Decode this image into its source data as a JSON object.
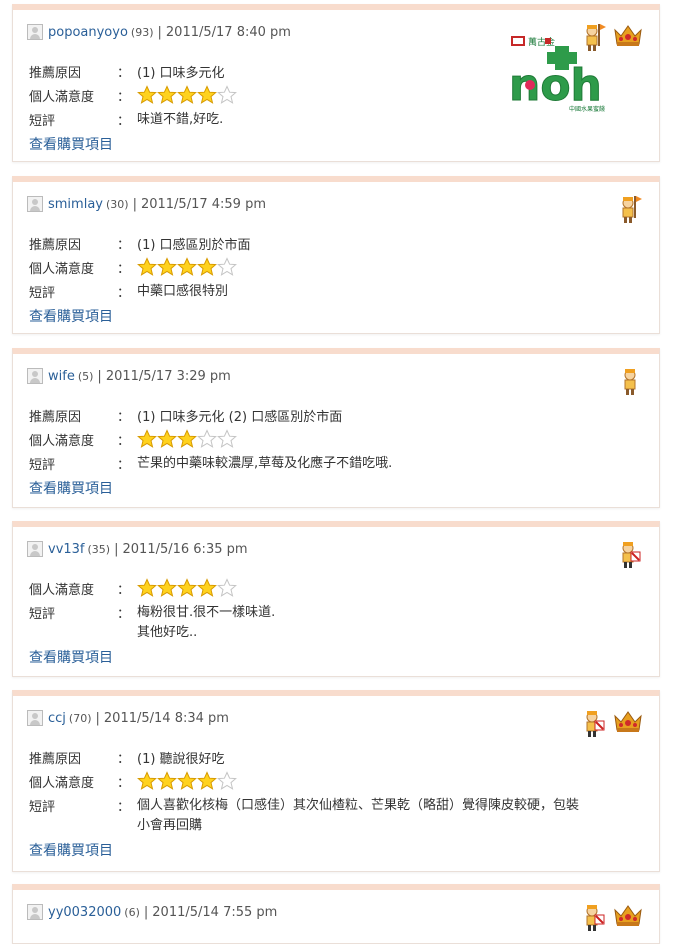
{
  "labels": {
    "reason": "推薦原因",
    "satisfaction": "個人滿意度",
    "comment": "短評",
    "colon": "：",
    "view_link": "查看購買項目"
  },
  "logo": {
    "text": "noh",
    "brand_small": "萬古金",
    "tagline": "中國水果蜜餞"
  },
  "reviews": [
    {
      "user": "popoanyoyo",
      "score": "(93)",
      "date": "2011/5/17  8:40 pm",
      "reason": "(1) 口味多元化",
      "rating": 4,
      "comment": [
        "味道不錯,好吃."
      ],
      "badges": [
        "person-flag-badge",
        "crown-badge"
      ]
    },
    {
      "user": "smimlay",
      "score": "(30)",
      "date": "2011/5/17  4:59 pm",
      "reason": "(1) 口感區別於市面",
      "rating": 4,
      "comment": [
        "中藥口感很特別"
      ],
      "badges": [
        "person-flag-badge"
      ]
    },
    {
      "user": "wife",
      "score": "(5)",
      "date": "2011/5/17  3:29 pm",
      "reason": "(1) 口味多元化   (2) 口感區別於市面",
      "rating": 3,
      "comment": [
        "芒果的中藥味較濃厚,草莓及化應子不錯吃哦."
      ],
      "badges": [
        "person-badge"
      ]
    },
    {
      "user": "vv13f",
      "score": "(35)",
      "date": "2011/5/16  6:35 pm",
      "reason": null,
      "rating": 4,
      "comment": [
        "梅粉很甘.很不一樣味道.",
        "其他好吃.."
      ],
      "badges": [
        "person-card-badge"
      ]
    },
    {
      "user": "ccj",
      "score": "(70)",
      "date": "2011/5/14  8:34 pm",
      "reason": "(1) 聽說很好吃",
      "rating": 4,
      "comment": [
        "個人喜歡化核梅（口感佳）其次仙楂粒、芒果乾（略甜）覺得陳皮較硬，包裝",
        "小會再回購"
      ],
      "badges": [
        "person-card-badge",
        "crown-badge"
      ]
    },
    {
      "user": "yy0032000",
      "score": "(6)",
      "date": "2011/5/14  7:55 pm",
      "reason": null,
      "rating": 0,
      "comment": [],
      "badges": [
        "person-card-badge",
        "crown-badge"
      ]
    }
  ]
}
